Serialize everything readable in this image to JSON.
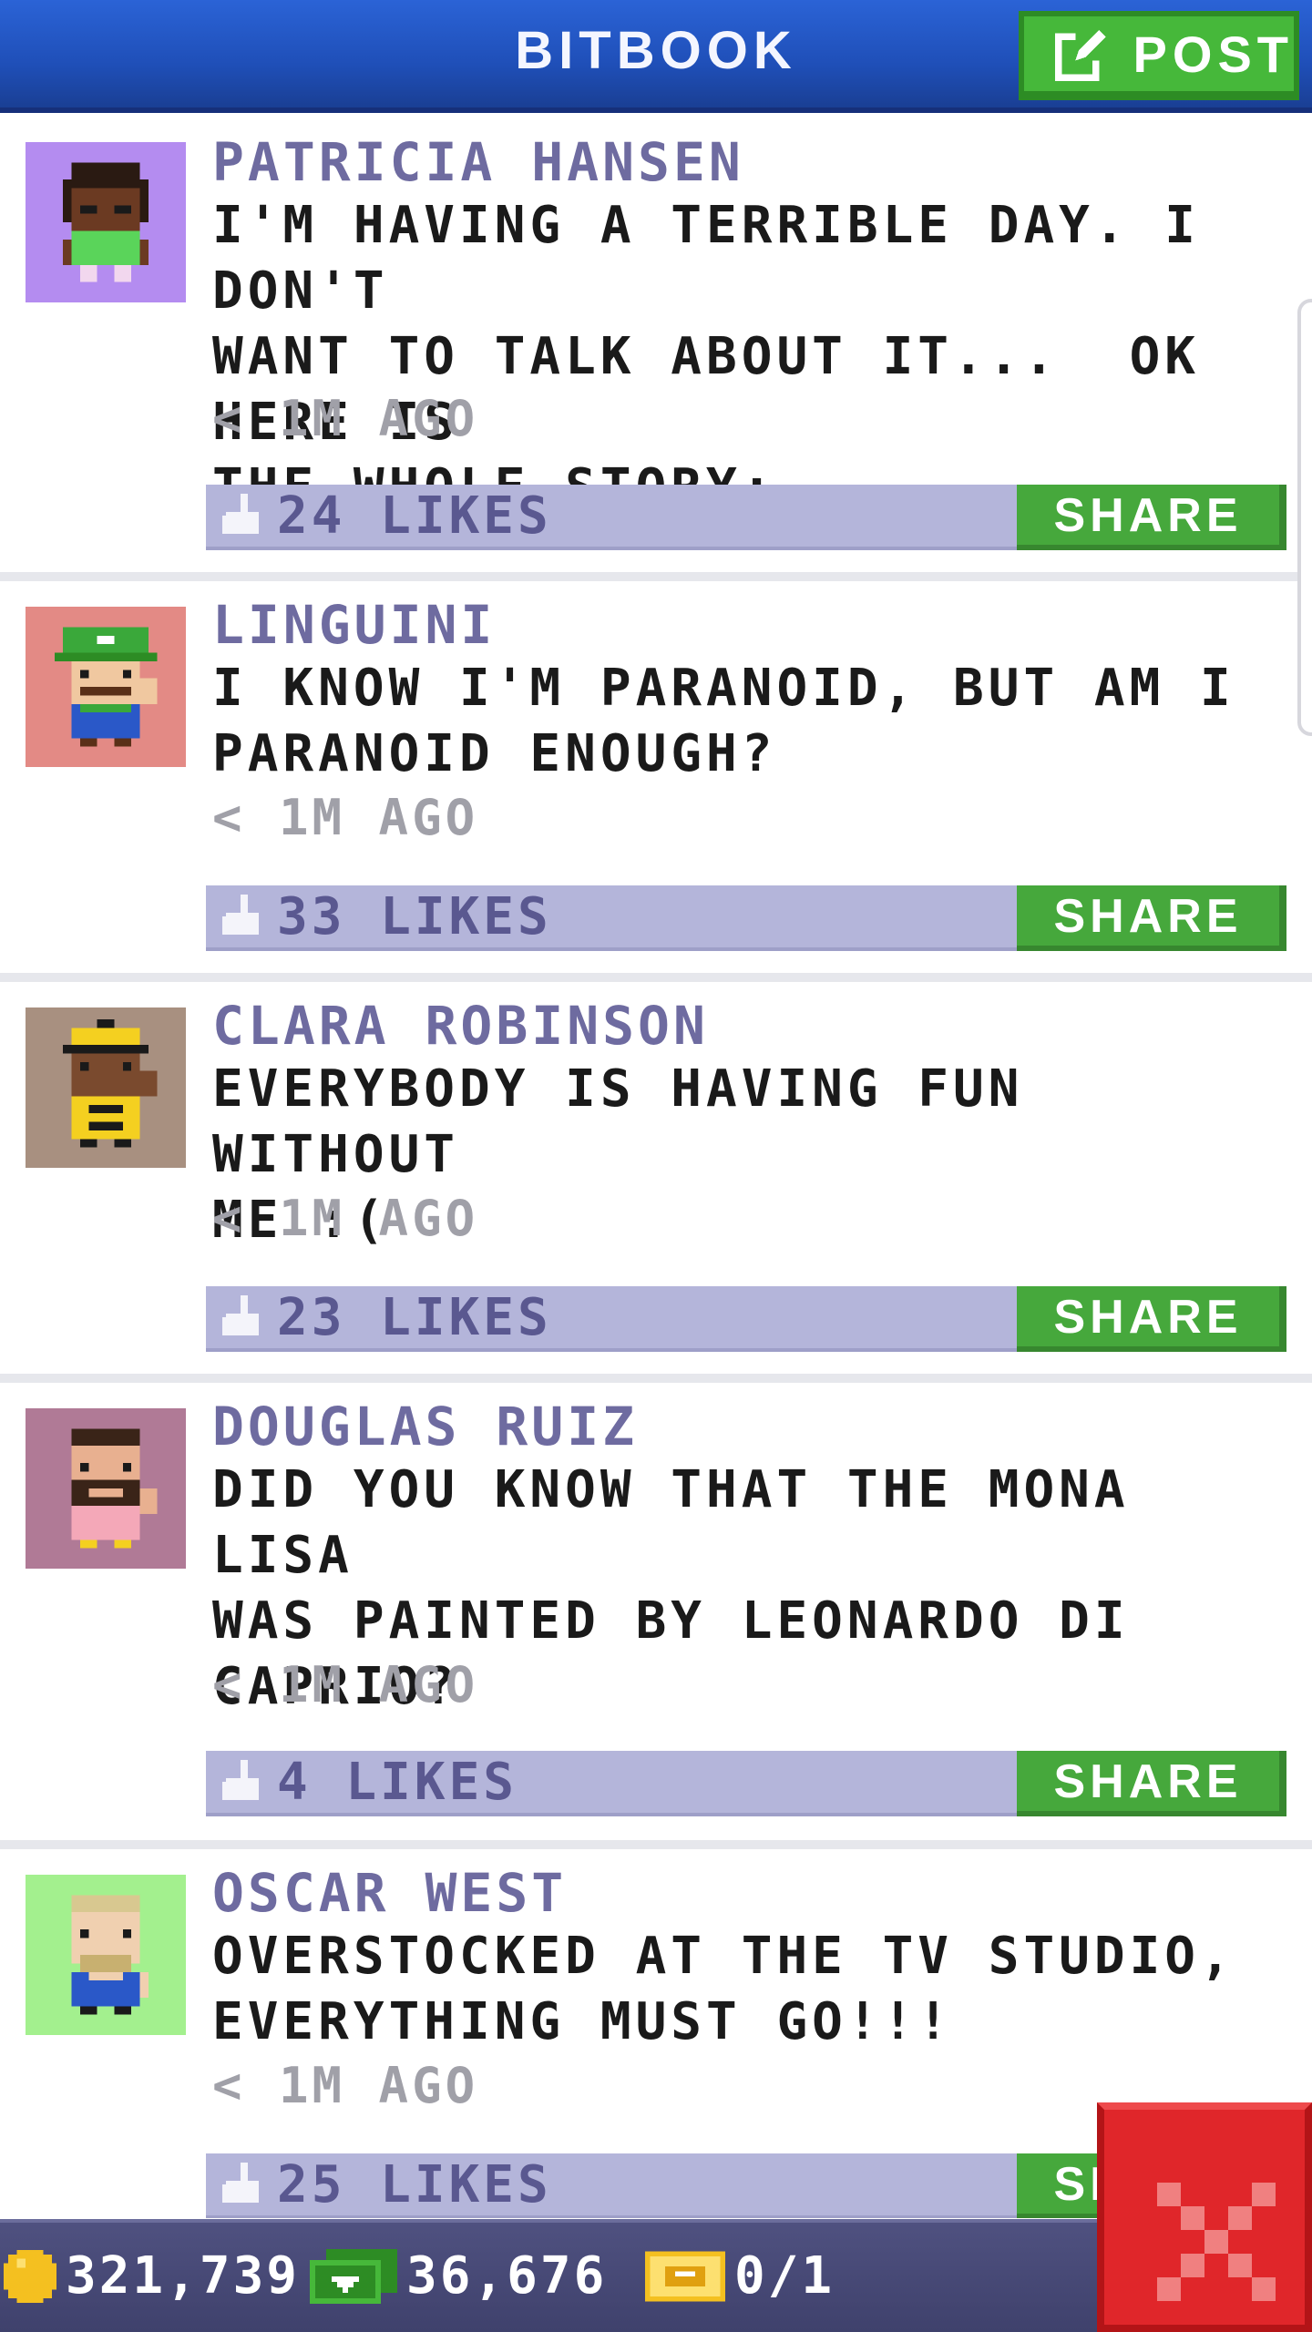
{
  "header": {
    "title": "BITBOOK",
    "post_label": "POST"
  },
  "posts": [
    {
      "author": "PATRICIA HANSEN",
      "message": "I'M HAVING A TERRIBLE DAY. I DON'T\nWANT TO TALK ABOUT IT...  OK HERE IS\nTHE WHOLE STORY:",
      "time": "< 1M AGO",
      "likes": "24 LIKES",
      "share_label": "SHARE",
      "avatar_bg": "#b48cf0"
    },
    {
      "author": "LINGUINI",
      "message": "I KNOW I'M PARANOID, BUT AM I\nPARANOID ENOUGH?",
      "time": "< 1M AGO",
      "likes": "33 LIKES",
      "share_label": "SHARE",
      "avatar_bg": "#e38a85"
    },
    {
      "author": "CLARA ROBINSON",
      "message": "EVERYBODY IS HAVING FUN WITHOUT\nME :(",
      "time": "< 1M AGO",
      "likes": "23 LIKES",
      "share_label": "SHARE",
      "avatar_bg": "#a89080"
    },
    {
      "author": "DOUGLAS RUIZ",
      "message": "DID YOU KNOW THAT THE MONA LISA\nWAS PAINTED BY LEONARDO DI\nCAPRIO?",
      "time": "< 1M AGO",
      "likes": "4 LIKES",
      "share_label": "SHARE",
      "avatar_bg": "#b07a96"
    },
    {
      "author": "OSCAR WEST",
      "message": "OVERSTOCKED AT THE TV STUDIO,\nEVERYTHING MUST GO!!!",
      "time": "< 1M AGO",
      "likes": "25 LIKES",
      "share_label": "SHARE",
      "avatar_bg": "#a3f08e"
    }
  ],
  "bottom_bar": {
    "coins": "321,739",
    "bux": "36,676",
    "tickets": "0/1"
  },
  "colors": {
    "header": "#2b63d6",
    "post_button": "#46b83a",
    "likes_bar": "#b4b5da",
    "share_button": "#46a83c",
    "close_button": "#e0262a"
  },
  "icons": {
    "post": "compose-icon",
    "like": "thumbs-up-icon",
    "coin": "coin-icon",
    "bux": "bux-icon",
    "ticket": "ticket-icon",
    "close": "close-icon"
  }
}
